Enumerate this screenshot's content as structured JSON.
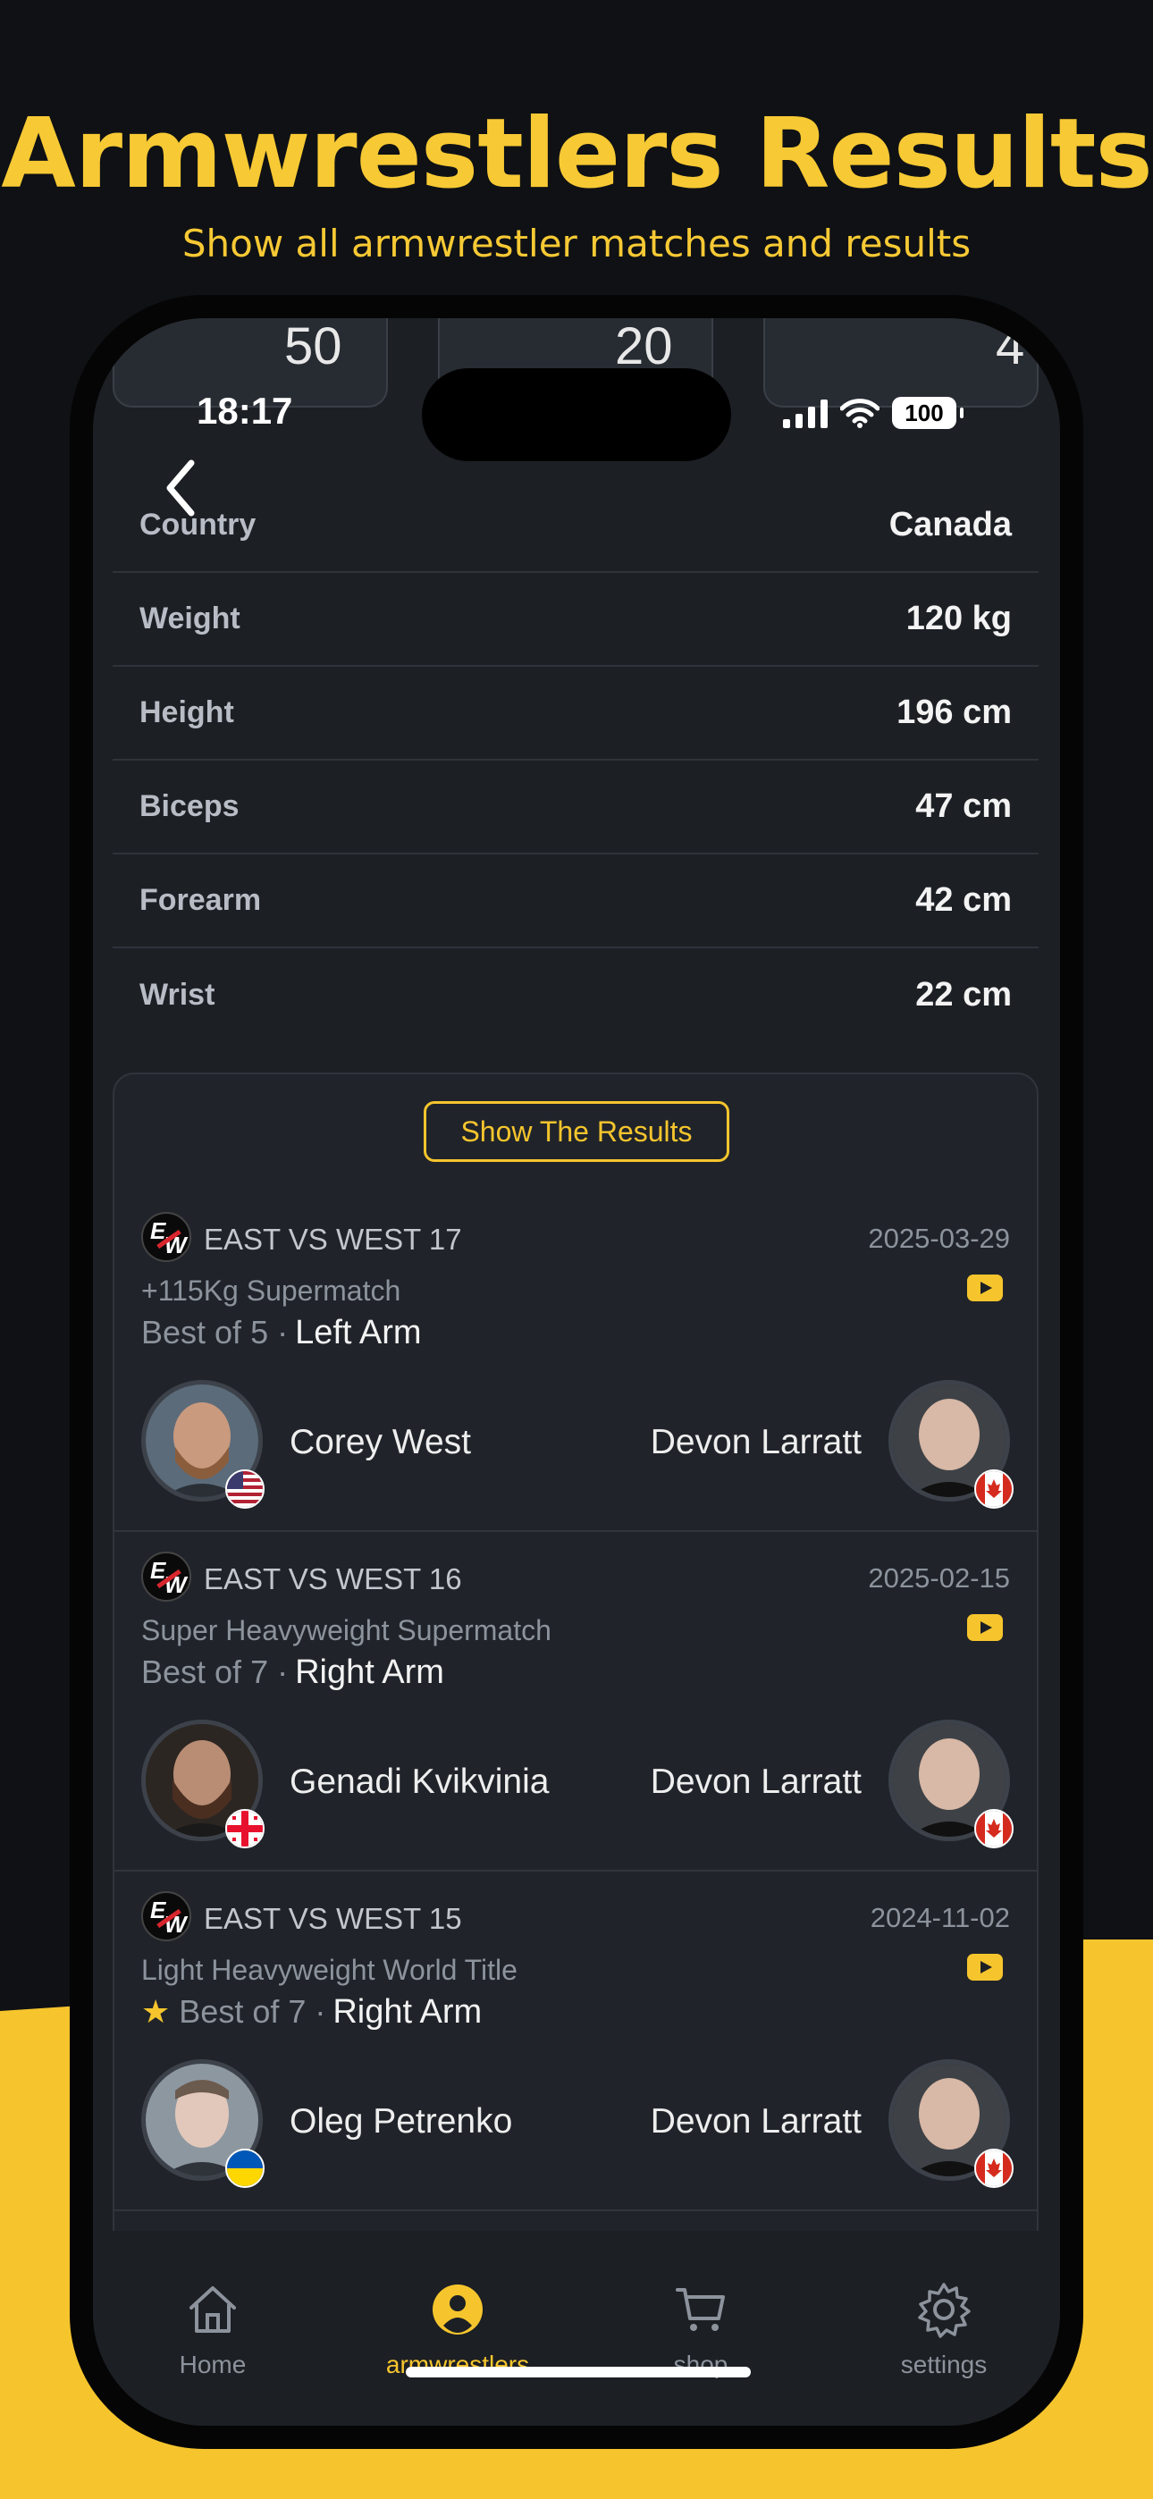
{
  "header": {
    "title": "Armwrestlers Results",
    "subtitle": "Show all armwrestler matches and results"
  },
  "status_bar": {
    "time": "18:17",
    "battery": "100",
    "tickers": [
      "50",
      "20",
      "4"
    ]
  },
  "profile": {
    "rows": [
      {
        "label": "Country",
        "value": "Canada"
      },
      {
        "label": "Weight",
        "value": "120 kg"
      },
      {
        "label": "Height",
        "value": "196 cm"
      },
      {
        "label": "Biceps",
        "value": "47 cm"
      },
      {
        "label": "Forearm",
        "value": "42 cm"
      },
      {
        "label": "Wrist",
        "value": "22 cm"
      }
    ]
  },
  "results": {
    "button_label": "Show The Results",
    "matches": [
      {
        "event": "EAST VS WEST 17",
        "date": "2025-03-29",
        "category": "+115Kg Supermatch",
        "best_of": "Best of 5 ·",
        "arm": "Left Arm",
        "title_star": false,
        "left_name": "Corey West",
        "left_flag": "usa",
        "right_name": "Devon Larratt",
        "right_flag": "canada"
      },
      {
        "event": "EAST VS WEST 16",
        "date": "2025-02-15",
        "category": "Super Heavyweight Supermatch",
        "best_of": "Best of 7 ·",
        "arm": "Right Arm",
        "title_star": false,
        "left_name": "Genadi Kvikvinia",
        "left_flag": "georgia",
        "right_name": "Devon Larratt",
        "right_flag": "canada"
      },
      {
        "event": "EAST VS WEST 15",
        "date": "2024-11-02",
        "category": "Light Heavyweight World Title",
        "best_of": "Best of 7 ·",
        "arm": "Right Arm",
        "title_star": true,
        "left_name": "Oleg Petrenko",
        "left_flag": "ukraine",
        "right_name": "Devon Larratt",
        "right_flag": "canada"
      }
    ]
  },
  "tabbar": {
    "items": [
      {
        "label": "Home",
        "icon": "home-icon"
      },
      {
        "label": "armwrestlers",
        "icon": "user-icon",
        "active": true
      },
      {
        "label": "shop",
        "icon": "cart-icon"
      },
      {
        "label": "settings",
        "icon": "gear-icon"
      }
    ]
  },
  "colors": {
    "accent": "#f6c52d",
    "background": "#0f1114",
    "card": "#20242a"
  }
}
